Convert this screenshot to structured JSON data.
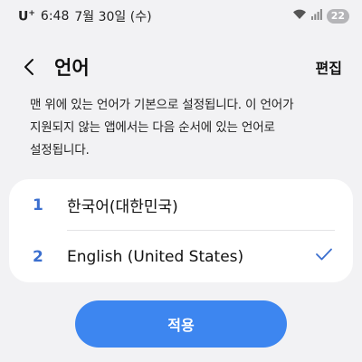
{
  "status_bar": {
    "carrier": "U",
    "carrier_sup": "+",
    "time": "6:48",
    "date": "7월 30일 (수)",
    "battery": "22"
  },
  "header": {
    "title": "언어",
    "edit_label": "편집"
  },
  "description": {
    "line1": "맨 위에 있는 언어가 기본으로 설정됩니다. 이 언어가",
    "line2": "지원되지 않는 앱에서는 다음 순서에 있는 언어로",
    "line3": "설정됩니다."
  },
  "languages": [
    {
      "index": "1",
      "name": "한국어(대한민국)",
      "selected": false
    },
    {
      "index": "2",
      "name": "English (United States)",
      "selected": true
    }
  ],
  "apply_label": "적용",
  "colors": {
    "accent": "#3d86f0",
    "index": "#3b6fcf",
    "background": "#f2f2f4"
  }
}
